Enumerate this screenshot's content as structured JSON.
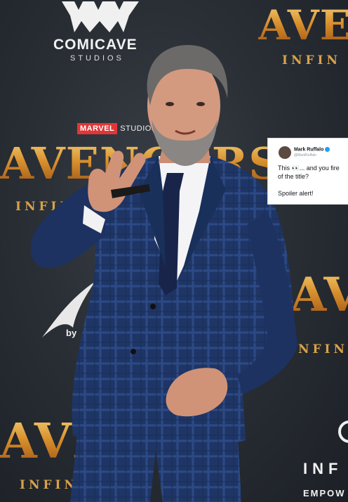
{
  "backdrop": {
    "comicave": "COMICAVE",
    "comicave_sub": "STUDIOS",
    "marvel": "MARVEL",
    "marvel_studios": "STUDIOS",
    "avengers_full": "AVENGERS",
    "aven": "AVEN",
    "infin": "INFIN",
    "infini": "INFINI",
    "inf": "INF",
    "empow": "EMPOW",
    "by": "by"
  },
  "tweet": {
    "name": "Mark Ruffalo",
    "handle": "@MarkRuffalo",
    "line1": "This 👀... and you fire",
    "line2": "of the title?",
    "line3": "Spoiler alert!"
  },
  "colors": {
    "backdrop": "#2a2f36",
    "logo_gold": "#d9912e",
    "suit_navy": "#1f3565",
    "tweet_bg": "#ffffff",
    "verified_blue": "#1da1f2"
  }
}
